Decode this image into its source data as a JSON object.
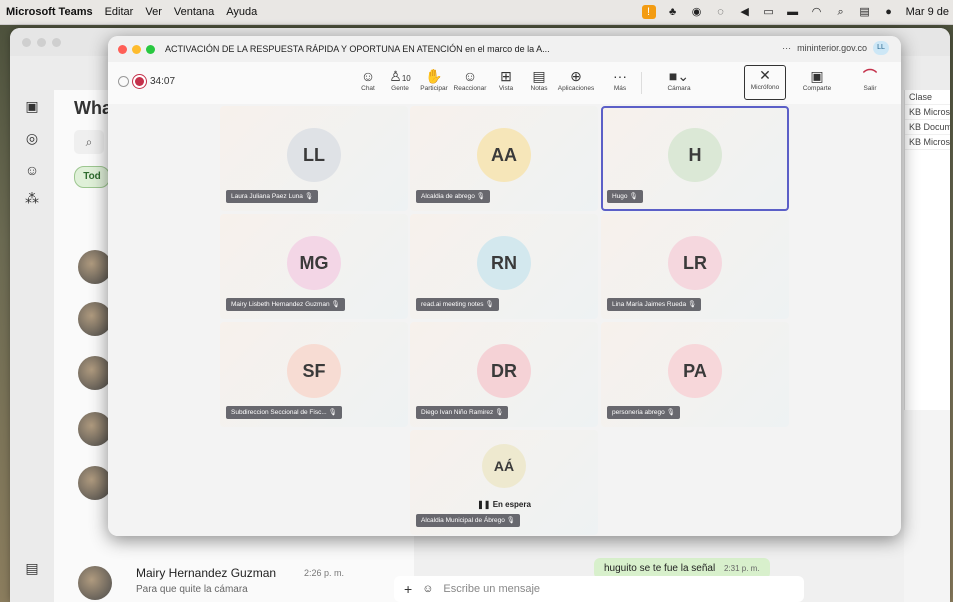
{
  "menubar": {
    "app_name": "Microsoft Teams",
    "items": [
      "Editar",
      "Ver",
      "Ventana",
      "Ayuda"
    ],
    "clock": "Mar 9 de"
  },
  "teams": {
    "heading": "Wha",
    "filter_label": "Tod",
    "chat_entry": {
      "name": "Mairy Hernandez Guzman",
      "message": "Para que quite la cámara",
      "time": "2:26 p. m."
    },
    "bubble": {
      "text": "huguito se te fue la señal",
      "time": "2:31 p. m."
    },
    "compose_placeholder": "Escribe un mensaje",
    "files": [
      "Clase",
      "KB Micros",
      "KB Docum",
      "KB Micros"
    ]
  },
  "meeting": {
    "title": "ACTIVACIÓN DE LA RESPUESTA RÁPIDA Y OPORTUNA EN ATENCIÓN en el marco de la A...",
    "domain": "mininterior.gov.co",
    "domain_badge": "LL",
    "timer": "34:07",
    "toolbar": {
      "chat": "Chat",
      "people": "Gente",
      "people_count": "10",
      "raise": "Participar",
      "react": "Reaccionar",
      "view": "Vista",
      "notes": "Notas",
      "apps": "Aplicaciones",
      "more": "Más",
      "camera": "Cámara",
      "mic": "Micrófono",
      "share": "Comparte",
      "leave": "Salir"
    },
    "participants": [
      {
        "initials": "LL",
        "name": "Laura Juliana Paez Luna",
        "color": "#dfe2e6"
      },
      {
        "initials": "AA",
        "name": "Alcaldia de abrego",
        "color": "#f6e6b9"
      },
      {
        "initials": "H",
        "name": "Hugo",
        "color": "#dbe8d6"
      },
      {
        "initials": "MG",
        "name": "Mairy Lisbeth Hernandez Guzman",
        "color": "#f3d6e6"
      },
      {
        "initials": "RN",
        "name": "read.ai meeting notes",
        "color": "#d3e8ee"
      },
      {
        "initials": "LR",
        "name": "Lina María Jaimes Rueda",
        "color": "#f5d7de"
      },
      {
        "initials": "SF",
        "name": "Subdireccion Seccional de Fisc...",
        "color": "#f7dcd3"
      },
      {
        "initials": "DR",
        "name": "Diego Ivan Niño Ramirez",
        "color": "#f5d2d6"
      },
      {
        "initials": "PA",
        "name": "personeria abrego",
        "color": "#f7d7da"
      },
      {
        "initials": "AÁ",
        "name": "Alcaldia Municipal de Ábrego",
        "color": "#eee9cf",
        "status": "En espera"
      }
    ]
  }
}
